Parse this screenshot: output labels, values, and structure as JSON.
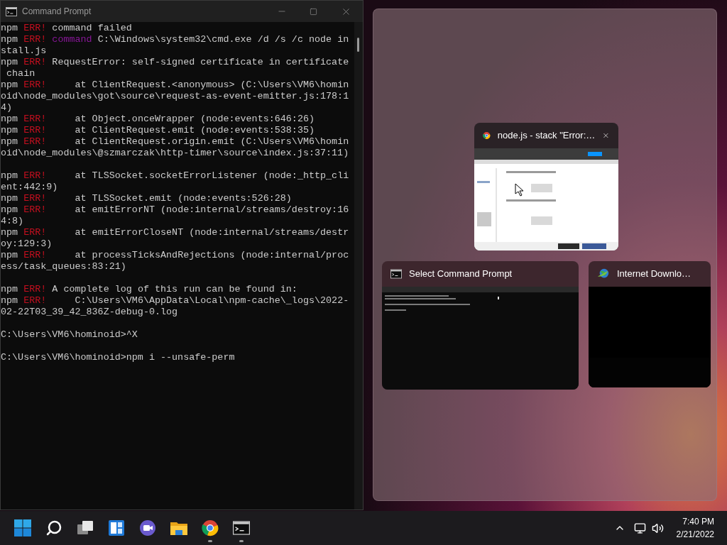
{
  "window": {
    "title": "Command Prompt"
  },
  "terminal": {
    "blocks": [
      {
        "lines": [
          {
            "parts": [
              {
                "text": "npm ",
                "kind": "plain"
              },
              {
                "text": "ERR!",
                "kind": "error"
              },
              {
                "text": " command failed",
                "kind": "plain"
              }
            ]
          },
          {
            "parts": [
              {
                "text": "npm ",
                "kind": "plain"
              },
              {
                "text": "ERR! ",
                "kind": "error"
              },
              {
                "text": "command",
                "kind": "keyword"
              },
              {
                "text": " C:\\Windows\\system32\\cmd.exe /d /s /c node in",
                "kind": "plain"
              }
            ]
          },
          {
            "parts": [
              {
                "text": "stall.js",
                "kind": "plain"
              }
            ]
          },
          {
            "parts": [
              {
                "text": "npm ",
                "kind": "plain"
              },
              {
                "text": "ERR!",
                "kind": "error"
              },
              {
                "text": " RequestError: self-signed certificate in certificate",
                "kind": "plain"
              }
            ]
          },
          {
            "parts": [
              {
                "text": " chain",
                "kind": "plain"
              }
            ]
          },
          {
            "parts": [
              {
                "text": "npm ",
                "kind": "plain"
              },
              {
                "text": "ERR!",
                "kind": "error"
              },
              {
                "text": "     at ClientRequest.<anonymous> (C:\\Users\\VM6\\homin",
                "kind": "plain"
              }
            ]
          },
          {
            "parts": [
              {
                "text": "oid\\node_modules\\got\\source\\request-as-event-emitter.js:178:1",
                "kind": "plain"
              }
            ]
          },
          {
            "parts": [
              {
                "text": "4)",
                "kind": "plain"
              }
            ]
          },
          {
            "parts": [
              {
                "text": "npm ",
                "kind": "plain"
              },
              {
                "text": "ERR!",
                "kind": "error"
              },
              {
                "text": "     at Object.onceWrapper (node:events:646:26)",
                "kind": "plain"
              }
            ]
          },
          {
            "parts": [
              {
                "text": "npm ",
                "kind": "plain"
              },
              {
                "text": "ERR!",
                "kind": "error"
              },
              {
                "text": "     at ClientRequest.emit (node:events:538:35)",
                "kind": "plain"
              }
            ]
          },
          {
            "parts": [
              {
                "text": "npm ",
                "kind": "plain"
              },
              {
                "text": "ERR!",
                "kind": "error"
              },
              {
                "text": "     at ClientRequest.origin.emit (C:\\Users\\VM6\\homin",
                "kind": "plain"
              }
            ]
          },
          {
            "parts": [
              {
                "text": "oid\\node_modules\\@szmarczak\\http-timer\\source\\index.js:37:11)",
                "kind": "plain"
              }
            ]
          }
        ]
      },
      {
        "lines": [
          {
            "parts": [
              {
                "text": "npm ",
                "kind": "plain"
              },
              {
                "text": "ERR!",
                "kind": "error"
              },
              {
                "text": "     at TLSSocket.socketErrorListener (node:_http_cli",
                "kind": "plain"
              }
            ]
          },
          {
            "parts": [
              {
                "text": "ent:442:9)",
                "kind": "plain"
              }
            ]
          },
          {
            "parts": [
              {
                "text": "npm ",
                "kind": "plain"
              },
              {
                "text": "ERR!",
                "kind": "error"
              },
              {
                "text": "     at TLSSocket.emit (node:events:526:28)",
                "kind": "plain"
              }
            ]
          },
          {
            "parts": [
              {
                "text": "npm ",
                "kind": "plain"
              },
              {
                "text": "ERR!",
                "kind": "error"
              },
              {
                "text": "     at emitErrorNT (node:internal/streams/destroy:16",
                "kind": "plain"
              }
            ]
          },
          {
            "parts": [
              {
                "text": "4:8)",
                "kind": "plain"
              }
            ]
          },
          {
            "parts": [
              {
                "text": "npm ",
                "kind": "plain"
              },
              {
                "text": "ERR!",
                "kind": "error"
              },
              {
                "text": "     at emitErrorCloseNT (node:internal/streams/destr",
                "kind": "plain"
              }
            ]
          },
          {
            "parts": [
              {
                "text": "oy:129:3)",
                "kind": "plain"
              }
            ]
          },
          {
            "parts": [
              {
                "text": "npm ",
                "kind": "plain"
              },
              {
                "text": "ERR!",
                "kind": "error"
              },
              {
                "text": "     at processTicksAndRejections (node:internal/proc",
                "kind": "plain"
              }
            ]
          },
          {
            "parts": [
              {
                "text": "ess/task_queues:83:21)",
                "kind": "plain"
              }
            ]
          }
        ]
      },
      {
        "lines": [
          {
            "parts": [
              {
                "text": "npm ",
                "kind": "plain"
              },
              {
                "text": "ERR!",
                "kind": "error"
              },
              {
                "text": " A complete log of this run can be found in:",
                "kind": "plain"
              }
            ]
          },
          {
            "parts": [
              {
                "text": "npm ",
                "kind": "plain"
              },
              {
                "text": "ERR!",
                "kind": "error"
              },
              {
                "text": "     C:\\Users\\VM6\\AppData\\Local\\npm-cache\\_logs\\2022-",
                "kind": "plain"
              }
            ]
          },
          {
            "parts": [
              {
                "text": "02-22T03_39_42_836Z-debug-0.log",
                "kind": "plain"
              }
            ]
          }
        ]
      },
      {
        "lines": [
          {
            "parts": [
              {
                "text": "C:\\Users\\VM6\\hominoid>^X",
                "kind": "plain"
              }
            ]
          }
        ]
      },
      {
        "lines": [
          {
            "parts": [
              {
                "text": "C:\\Users\\VM6\\hominoid>npm i --unsafe-perm",
                "kind": "plain"
              }
            ]
          }
        ]
      }
    ]
  },
  "snap_assist": {
    "windows": [
      {
        "title": "node.js - stack \"Error:…",
        "kind": "browser",
        "hovered": true
      },
      {
        "title": "Select Command Prompt",
        "kind": "console",
        "hovered": false
      },
      {
        "title": "Internet Downlo…",
        "kind": "downloader",
        "hovered": false
      }
    ]
  },
  "taskbar": {
    "apps": [
      {
        "kind": "start",
        "running": false
      },
      {
        "kind": "search",
        "running": false
      },
      {
        "kind": "taskview",
        "running": false
      },
      {
        "kind": "widgets",
        "running": false
      },
      {
        "kind": "chat",
        "running": false
      },
      {
        "kind": "explorer",
        "running": false
      },
      {
        "kind": "browser",
        "running": true
      },
      {
        "kind": "console",
        "running": true
      }
    ],
    "clock": {
      "time": "7:40 PM",
      "date": "2/21/2022"
    }
  }
}
